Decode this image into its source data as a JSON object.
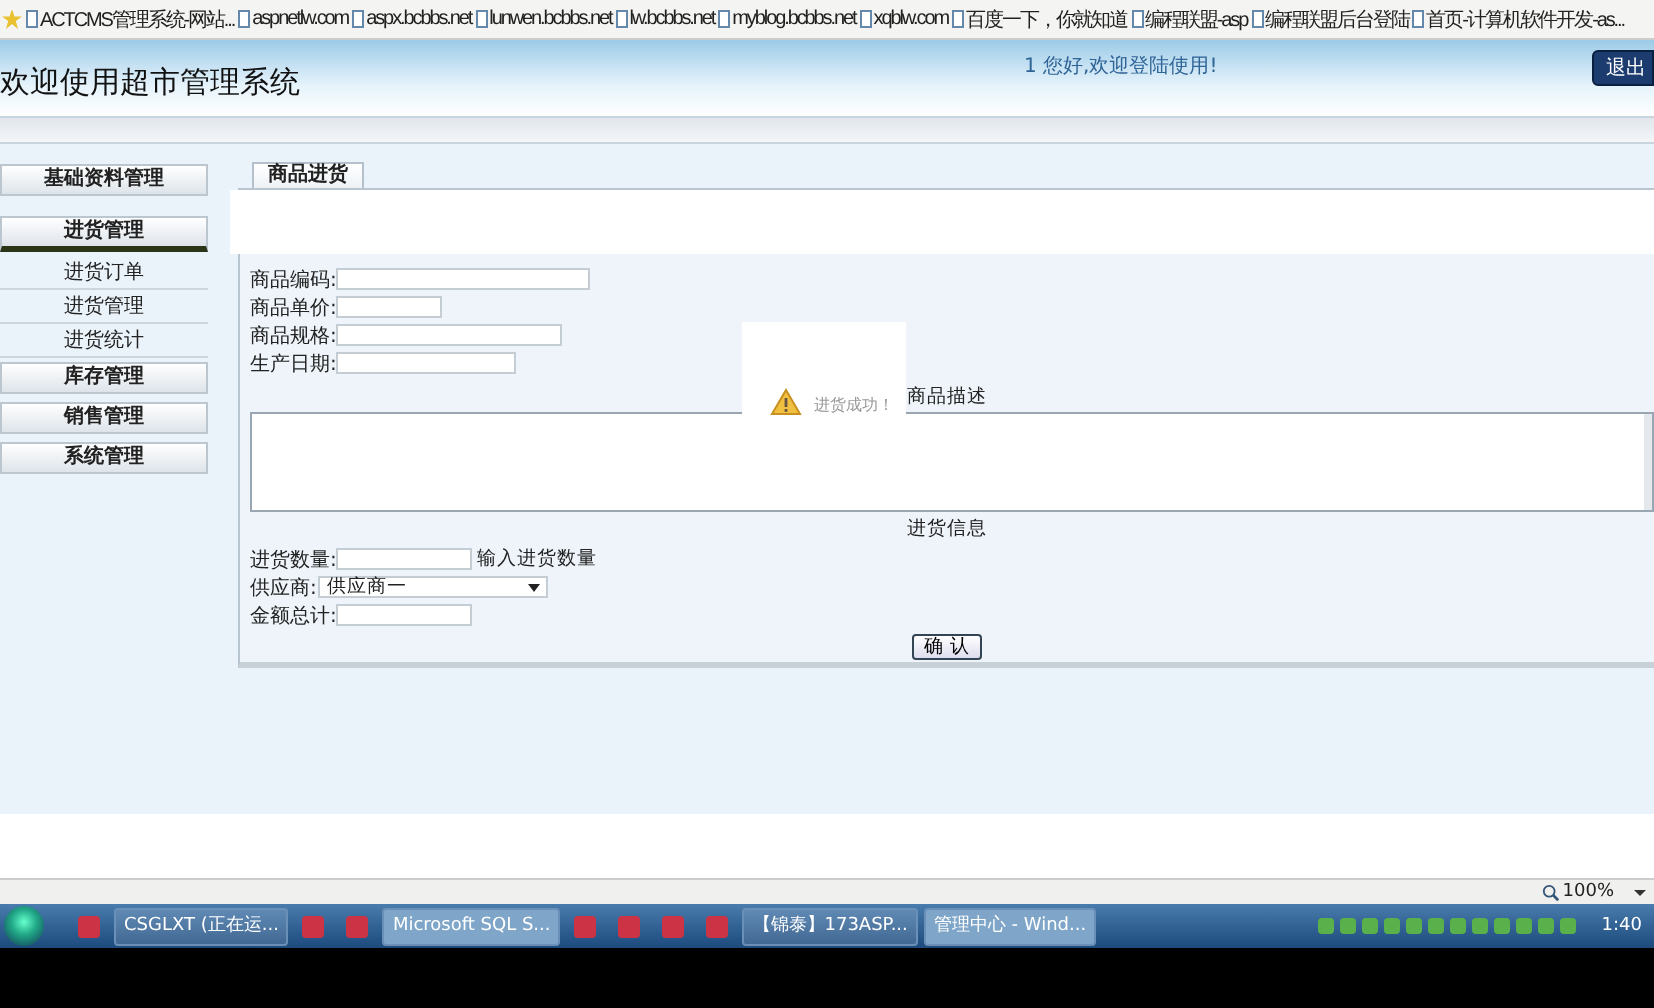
{
  "bookmarks": [
    {
      "label": "ACTCMS管理系统-网站..."
    },
    {
      "label": "aspnetlw.com"
    },
    {
      "label": "aspx.bcbbs.net"
    },
    {
      "label": "lunwen.bcbbs.net"
    },
    {
      "label": "lw.bcbbs.net"
    },
    {
      "label": "myblog.bcbbs.net"
    },
    {
      "label": "xqblw.com"
    },
    {
      "label": "百度一下，你就知道"
    },
    {
      "label": "编程联盟-asp"
    },
    {
      "label": "编程联盟后台登陆"
    },
    {
      "label": "首页-计算机软件开发-as..."
    }
  ],
  "header": {
    "title": "欢迎使用超市管理系统",
    "notice": "1 您好,欢迎登陆使用!",
    "logout": "退出"
  },
  "sidebar": [
    {
      "label": "基础资料管理",
      "expanded": false
    },
    {
      "label": "进货管理",
      "expanded": true,
      "children": [
        {
          "label": "进货订单"
        },
        {
          "label": "进货管理"
        },
        {
          "label": "进货统计"
        }
      ]
    },
    {
      "label": "库存管理",
      "expanded": false
    },
    {
      "label": "销售管理",
      "expanded": false
    },
    {
      "label": "系统管理",
      "expanded": false
    }
  ],
  "tab": {
    "label": "商品进货"
  },
  "fields": [
    {
      "label": "商品编码:"
    },
    {
      "label": "商品单价:"
    },
    {
      "label": "商品规格:"
    },
    {
      "label": "生产日期:"
    }
  ],
  "description": {
    "heading": "商品描述"
  },
  "purchase": {
    "heading": "进货信息",
    "quantity": {
      "label": "进货数量:",
      "hint": "输入进货数量"
    },
    "supplier": {
      "label": "供应商:",
      "value": "供应商一"
    },
    "total": {
      "label": "金额总计:"
    }
  },
  "confirm": "确 认",
  "toast": {
    "message": "进货成功！"
  },
  "status_bar": {
    "zoom": "100%"
  },
  "taskbar": {
    "items": [
      {
        "label": "CSGLXT (正在运...",
        "active": false
      },
      {
        "label": "Microsoft SQL S...",
        "active": true
      },
      {
        "label": "【锦泰】173ASP...",
        "active": false
      },
      {
        "label": "管理中心 - Wind...",
        "active": true
      }
    ],
    "clock": "1:40"
  }
}
